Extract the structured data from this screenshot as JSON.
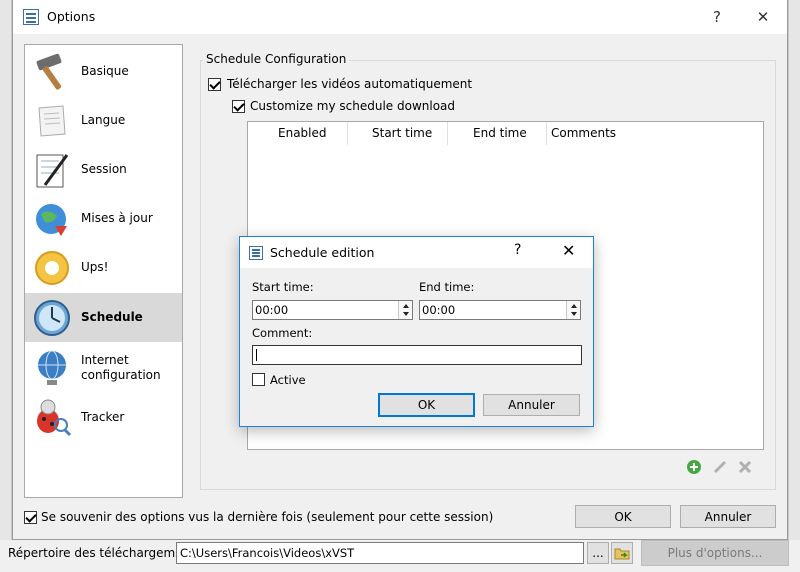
{
  "window": {
    "title": "Options",
    "help": "?",
    "close": "✕"
  },
  "sidebar": {
    "items": [
      {
        "label": "Basique",
        "icon": "hammer-icon"
      },
      {
        "label": "Langue",
        "icon": "scroll-icon"
      },
      {
        "label": "Session",
        "icon": "notepad-pen-icon"
      },
      {
        "label": "Mises à jour",
        "icon": "globe-update-icon"
      },
      {
        "label": "Ups!",
        "icon": "lifebuoy-icon"
      },
      {
        "label": "Schedule",
        "icon": "clock-icon"
      },
      {
        "label": "Internet configuration",
        "line1": "Internet",
        "line2": "configuration",
        "icon": "network-globe-icon"
      },
      {
        "label": "Tracker",
        "icon": "bug-magnifier-icon"
      }
    ],
    "selected": "Schedule"
  },
  "schedule": {
    "group_title": "Schedule Configuration",
    "auto_download_label": "Télécharger les vidéos automatiquement",
    "auto_download_checked": true,
    "customize_label": "Customize my schedule download",
    "customize_checked": true,
    "columns": [
      "Enabled",
      "Start time",
      "End time",
      "Comments"
    ],
    "rows": []
  },
  "remember": {
    "label": "Se souvenir des options vus la dernière fois (seulement pour cette session)",
    "checked": true
  },
  "buttons": {
    "ok": "OK",
    "cancel": "Annuler"
  },
  "download_dir": {
    "label": "Répertoire des téléchargements :",
    "value": "C:\\Users\\Francois\\Videos\\xVST",
    "browse": "...",
    "more_options": "Plus d'options..."
  },
  "dialog": {
    "title": "Schedule edition",
    "help": "?",
    "close": "✕",
    "start_label": "Start time:",
    "start_value": "00:00",
    "end_label": "End time:",
    "end_value": "00:00",
    "comment_label": "Comment:",
    "comment_value": "",
    "active_label": "Active",
    "active_checked": false,
    "ok": "OK",
    "cancel": "Annuler"
  },
  "colors": {
    "accent": "#0078d7",
    "selected_item": "#d9d9d9"
  }
}
